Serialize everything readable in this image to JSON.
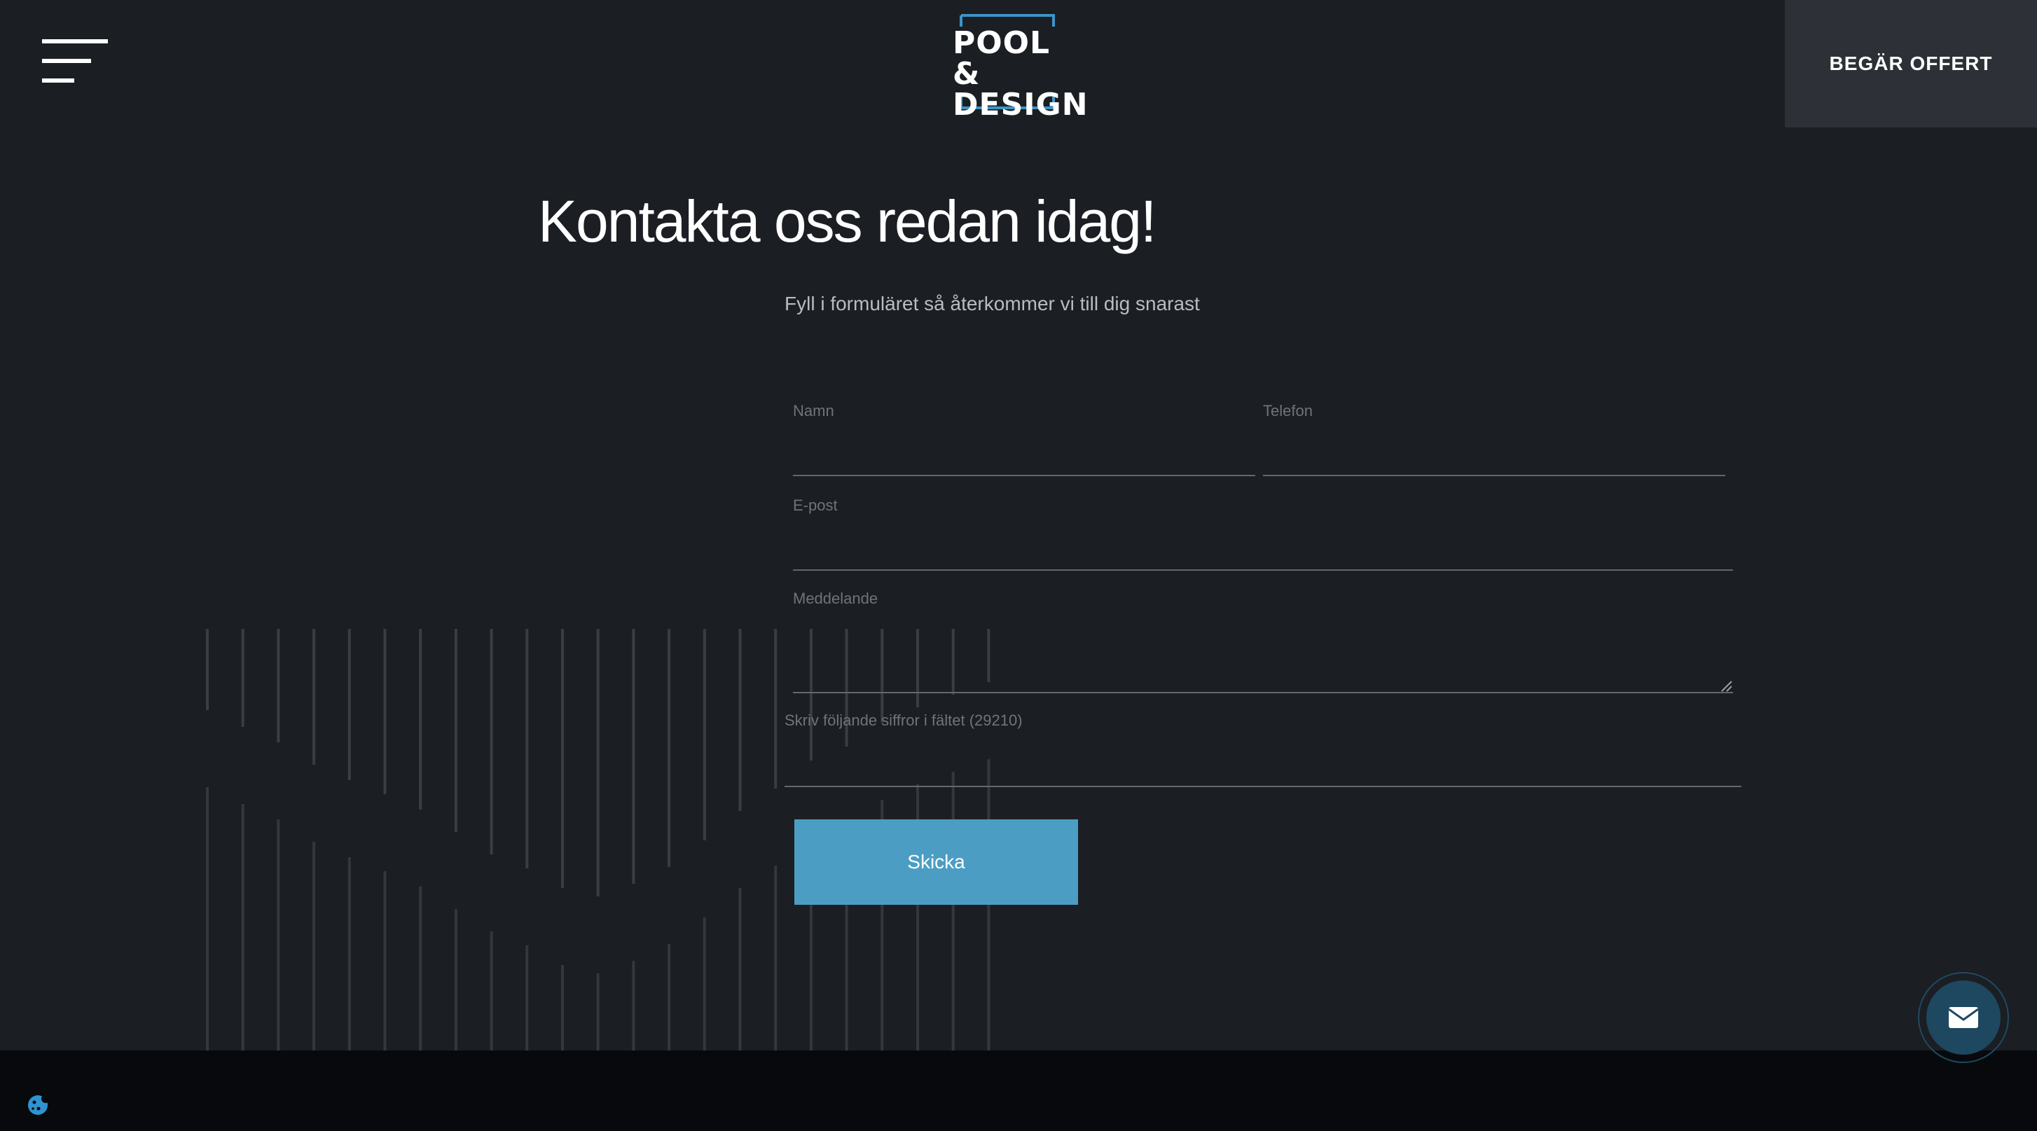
{
  "header": {
    "logo_text_line1": "POOL &",
    "logo_text_line2": "DESIGN",
    "offer_button_label": "BEGÄR OFFERT"
  },
  "main": {
    "title": "Kontakta oss redan idag!",
    "subtitle": "Fyll i formuläret så återkommer vi till dig snarast"
  },
  "form": {
    "name_label": "Namn",
    "phone_label": "Telefon",
    "email_label": "E-post",
    "message_label": "Meddelande",
    "captcha_label": "Skriv följande siffror i fältet (29210)",
    "name_value": "",
    "phone_value": "",
    "email_value": "",
    "message_value": "",
    "captcha_value": "",
    "submit_label": "Skicka"
  },
  "icons": {
    "menu": "hamburger-menu-icon",
    "chat": "envelope-icon",
    "cookie": "cookie-icon"
  },
  "colors": {
    "background": "#1b1e23",
    "accent": "#4c9dc4",
    "logo_frame": "#3c95c8",
    "offer_button_bg": "#2d3036",
    "footer_bg": "#07090c"
  }
}
